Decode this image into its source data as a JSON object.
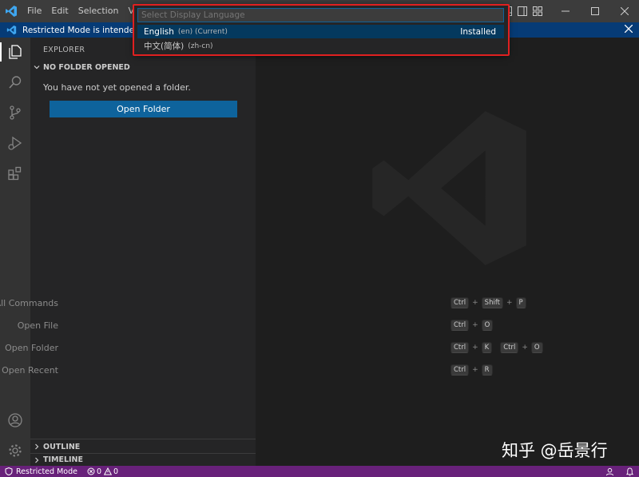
{
  "titlebar": {
    "menu": [
      "File",
      "Edit",
      "Selection",
      "View"
    ]
  },
  "banner": {
    "text": "Restricted Mode is intended for sa"
  },
  "sidebar": {
    "title": "EXPLORER",
    "section_header": "NO FOLDER OPENED",
    "message": "You have not yet opened a folder.",
    "open_folder_label": "Open Folder",
    "outline_label": "OUTLINE",
    "timeline_label": "TIMELINE"
  },
  "quickpick": {
    "placeholder": "Select Display Language",
    "items": [
      {
        "label": "English",
        "description": "(en) (Current)",
        "badge": "Installed"
      },
      {
        "label": "中文(简体)",
        "description": "(zh-cn)",
        "badge": ""
      }
    ]
  },
  "shortcuts": [
    {
      "label": "Show All Commands",
      "keys": [
        "Ctrl",
        "+",
        "Shift",
        "+",
        "P"
      ]
    },
    {
      "label": "Open File",
      "keys": [
        "Ctrl",
        "+",
        "O"
      ]
    },
    {
      "label": "Open Folder",
      "keys": [
        "Ctrl",
        "+",
        "K",
        "",
        "Ctrl",
        "+",
        "O"
      ]
    },
    {
      "label": "Open Recent",
      "keys": [
        "Ctrl",
        "+",
        "R"
      ]
    }
  ],
  "statusbar": {
    "restricted_label": "Restricted Mode",
    "errors": "0",
    "warnings": "0"
  },
  "watermark_text": "知乎 @岳景行",
  "colors": {
    "accent": "#0e639c",
    "statusbar": "#68217a",
    "banner": "#063b76",
    "highlight": "#e02020"
  },
  "icons": [
    "vscode-logo-icon",
    "explorer-icon",
    "search-icon",
    "source-control-icon",
    "run-debug-icon",
    "extensions-icon",
    "account-icon",
    "manage-gear-icon"
  ]
}
